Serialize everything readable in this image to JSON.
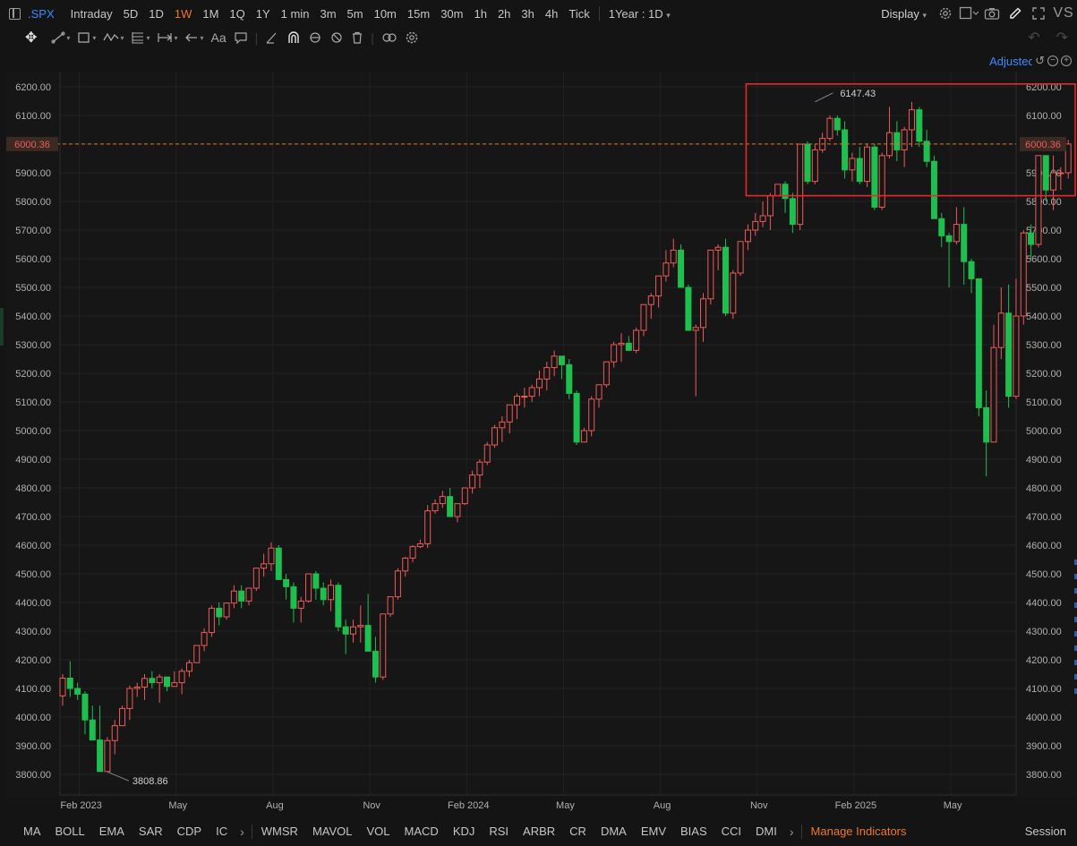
{
  "toolbar": {
    "symbol": ".SPX",
    "timeframes": [
      {
        "label": "Intraday",
        "active": false
      },
      {
        "label": "5D",
        "active": false
      },
      {
        "label": "1D",
        "active": false
      },
      {
        "label": "1W",
        "active": true
      },
      {
        "label": "1M",
        "active": false
      },
      {
        "label": "1Q",
        "active": false
      },
      {
        "label": "1Y",
        "active": false
      },
      {
        "label": "1 min",
        "active": false
      },
      {
        "label": "3m",
        "active": false
      },
      {
        "label": "5m",
        "active": false
      },
      {
        "label": "10m",
        "active": false
      },
      {
        "label": "15m",
        "active": false
      },
      {
        "label": "30m",
        "active": false
      },
      {
        "label": "1h",
        "active": false
      },
      {
        "label": "2h",
        "active": false
      },
      {
        "label": "3h",
        "active": false
      },
      {
        "label": "4h",
        "active": false
      },
      {
        "label": "Tick",
        "active": false
      }
    ],
    "range_label": "1Year : 1D",
    "display_label": "Display",
    "vs_label": "VS"
  },
  "price_mode": "Adjusted",
  "colors": {
    "up": "#f05a5a",
    "down": "#1fbf4f",
    "accent": "#f07828",
    "link": "#3d8bff",
    "current_line": "#e0762e",
    "highlight_box": "#e8282a"
  },
  "chart_data": {
    "type": "candlestick",
    "symbol": ".SPX",
    "interval": "1W",
    "ylim": [
      3750,
      6250
    ],
    "y_ticks": [
      "6200.00",
      "6100.00",
      "6000.00",
      "5900.00",
      "5800.00",
      "5700.00",
      "5600.00",
      "5500.00",
      "5400.00",
      "5300.00",
      "5200.00",
      "5100.00",
      "5000.00",
      "4900.00",
      "4800.00",
      "4700.00",
      "4600.00",
      "4500.00",
      "4400.00",
      "4300.00",
      "4200.00",
      "4100.00",
      "4000.00",
      "3900.00",
      "3800.00"
    ],
    "x_ticks": [
      {
        "label": "Feb 2023",
        "week": 2
      },
      {
        "label": "May",
        "week": 15
      },
      {
        "label": "Aug",
        "week": 28
      },
      {
        "label": "Nov",
        "week": 41
      },
      {
        "label": "Feb 2024",
        "week": 54
      },
      {
        "label": "May",
        "week": 67
      },
      {
        "label": "Aug",
        "week": 80
      },
      {
        "label": "Nov",
        "week": 93
      },
      {
        "label": "Feb 2025",
        "week": 106
      },
      {
        "label": "May",
        "week": 119
      }
    ],
    "current_price": "6000.36",
    "annotations": [
      {
        "label": "6147.43",
        "price": 6147.43,
        "week": 101
      },
      {
        "label": "3808.86",
        "price": 3808.86,
        "week": 6
      }
    ],
    "highlight_range": {
      "from_week": 92,
      "price_top": 6210,
      "price_bottom": 5820
    },
    "ohlc": [
      [
        4074,
        4150,
        4040,
        4136
      ],
      [
        4136,
        4195,
        4070,
        4100
      ],
      [
        4100,
        4120,
        4060,
        4080
      ],
      [
        4080,
        4090,
        3940,
        3990
      ],
      [
        3990,
        4040,
        3920,
        3920
      ],
      [
        3920,
        4040,
        3840,
        3810
      ],
      [
        3810,
        3930,
        3808.86,
        3918
      ],
      [
        3918,
        3990,
        3870,
        3970
      ],
      [
        3970,
        4040,
        3970,
        4030
      ],
      [
        4030,
        4110,
        3990,
        4100
      ],
      [
        4100,
        4120,
        4070,
        4105
      ],
      [
        4105,
        4150,
        4060,
        4135
      ],
      [
        4135,
        4160,
        4100,
        4120
      ],
      [
        4120,
        4150,
        4050,
        4140
      ],
      [
        4140,
        4140,
        4090,
        4107
      ],
      [
        4107,
        4160,
        4110,
        4120
      ],
      [
        4120,
        4170,
        4080,
        4160
      ],
      [
        4160,
        4200,
        4140,
        4190
      ],
      [
        4190,
        4250,
        4200,
        4250
      ],
      [
        4250,
        4310,
        4230,
        4295
      ],
      [
        4295,
        4390,
        4280,
        4380
      ],
      [
        4380,
        4400,
        4320,
        4350
      ],
      [
        4350,
        4400,
        4340,
        4398
      ],
      [
        4398,
        4460,
        4380,
        4440
      ],
      [
        4440,
        4460,
        4380,
        4405
      ],
      [
        4405,
        4450,
        4390,
        4450
      ],
      [
        4450,
        4520,
        4440,
        4520
      ],
      [
        4520,
        4570,
        4490,
        4535
      ],
      [
        4535,
        4610,
        4510,
        4590
      ],
      [
        4590,
        4600,
        4490,
        4480
      ],
      [
        4480,
        4500,
        4410,
        4455
      ],
      [
        4455,
        4470,
        4330,
        4380
      ],
      [
        4380,
        4420,
        4330,
        4405
      ],
      [
        4405,
        4480,
        4400,
        4500
      ],
      [
        4500,
        4510,
        4410,
        4450
      ],
      [
        4450,
        4470,
        4390,
        4410
      ],
      [
        4410,
        4480,
        4370,
        4460
      ],
      [
        4460,
        4470,
        4300,
        4315
      ],
      [
        4315,
        4340,
        4220,
        4290
      ],
      [
        4290,
        4340,
        4260,
        4315
      ],
      [
        4315,
        4390,
        4260,
        4320
      ],
      [
        4320,
        4430,
        4260,
        4230
      ],
      [
        4230,
        4280,
        4120,
        4140
      ],
      [
        4140,
        4360,
        4130,
        4360
      ],
      [
        4360,
        4420,
        4350,
        4420
      ],
      [
        4420,
        4520,
        4410,
        4510
      ],
      [
        4510,
        4560,
        4490,
        4555
      ],
      [
        4555,
        4600,
        4540,
        4595
      ],
      [
        4595,
        4620,
        4590,
        4605
      ],
      [
        4605,
        4740,
        4590,
        4720
      ],
      [
        4720,
        4760,
        4710,
        4745
      ],
      [
        4745,
        4790,
        4730,
        4770
      ],
      [
        4770,
        4800,
        4700,
        4700
      ],
      [
        4700,
        4720,
        4680,
        4745
      ],
      [
        4745,
        4790,
        4740,
        4800
      ],
      [
        4800,
        4860,
        4780,
        4845
      ],
      [
        4845,
        4900,
        4800,
        4890
      ],
      [
        4890,
        4960,
        4880,
        4950
      ],
      [
        4950,
        5020,
        4940,
        5010
      ],
      [
        5010,
        5050,
        4960,
        5030
      ],
      [
        5030,
        5060,
        4990,
        5090
      ],
      [
        5090,
        5130,
        5040,
        5120
      ],
      [
        5120,
        5150,
        5080,
        5120
      ],
      [
        5120,
        5160,
        5100,
        5150
      ],
      [
        5150,
        5210,
        5120,
        5180
      ],
      [
        5180,
        5240,
        5140,
        5220
      ],
      [
        5220,
        5280,
        5190,
        5260
      ],
      [
        5260,
        5260,
        5180,
        5230
      ],
      [
        5230,
        5250,
        5110,
        5130
      ],
      [
        5130,
        5140,
        4950,
        4960
      ],
      [
        4960,
        5010,
        4970,
        5000
      ],
      [
        5000,
        5120,
        4980,
        5110
      ],
      [
        5110,
        5150,
        5080,
        5160
      ],
      [
        5160,
        5200,
        5150,
        5240
      ],
      [
        5240,
        5310,
        5220,
        5300
      ],
      [
        5300,
        5340,
        5240,
        5305
      ],
      [
        5305,
        5330,
        5280,
        5280
      ],
      [
        5280,
        5360,
        5270,
        5350
      ],
      [
        5350,
        5400,
        5330,
        5440
      ],
      [
        5440,
        5480,
        5390,
        5470
      ],
      [
        5470,
        5540,
        5430,
        5540
      ],
      [
        5540,
        5630,
        5520,
        5585
      ],
      [
        5585,
        5670,
        5570,
        5630
      ],
      [
        5630,
        5650,
        5500,
        5500
      ],
      [
        5500,
        5510,
        5380,
        5350
      ],
      [
        5350,
        5370,
        5120,
        5360
      ],
      [
        5360,
        5480,
        5310,
        5460
      ],
      [
        5460,
        5600,
        5440,
        5630
      ],
      [
        5630,
        5650,
        5560,
        5640
      ],
      [
        5640,
        5670,
        5400,
        5410
      ],
      [
        5410,
        5560,
        5390,
        5550
      ],
      [
        5550,
        5660,
        5540,
        5660
      ],
      [
        5660,
        5720,
        5630,
        5700
      ],
      [
        5700,
        5760,
        5680,
        5730
      ],
      [
        5730,
        5800,
        5710,
        5750
      ],
      [
        5750,
        5830,
        5700,
        5820
      ],
      [
        5820,
        5860,
        5820,
        5860
      ],
      [
        5860,
        5870,
        5760,
        5810
      ],
      [
        5810,
        5830,
        5690,
        5720
      ],
      [
        5720,
        5880,
        5700,
        6000
      ],
      [
        6000,
        6010,
        5860,
        5870
      ],
      [
        5870,
        6000,
        5860,
        5980
      ],
      [
        5980,
        6040,
        5970,
        6020
      ],
      [
        6020,
        6100,
        6010,
        6090
      ],
      [
        6090,
        6100,
        6030,
        6050
      ],
      [
        6050,
        6080,
        5880,
        5910
      ],
      [
        5910,
        5970,
        5870,
        5950
      ],
      [
        5950,
        5990,
        5860,
        5870
      ],
      [
        5870,
        6000,
        5850,
        5990
      ],
      [
        5990,
        6000,
        5770,
        5780
      ],
      [
        5780,
        5970,
        5770,
        5960
      ],
      [
        5960,
        6130,
        5950,
        6040
      ],
      [
        6040,
        6080,
        5940,
        5980
      ],
      [
        5980,
        6060,
        5920,
        6050
      ],
      [
        6050,
        6147.43,
        5990,
        6120
      ],
      [
        6120,
        6130,
        5990,
        6010
      ],
      [
        6010,
        6050,
        5920,
        5940
      ],
      [
        5940,
        5960,
        5770,
        5740
      ],
      [
        5740,
        5760,
        5640,
        5680
      ],
      [
        5680,
        5690,
        5500,
        5660
      ],
      [
        5660,
        5780,
        5650,
        5720
      ],
      [
        5720,
        5780,
        5510,
        5590
      ],
      [
        5590,
        5600,
        5480,
        5530
      ],
      [
        5530,
        5530,
        5050,
        5080
      ],
      [
        5080,
        5140,
        4840,
        4960
      ],
      [
        4960,
        5370,
        4960,
        5290
      ],
      [
        5290,
        5500,
        5250,
        5410
      ],
      [
        5410,
        5510,
        5080,
        5120
      ],
      [
        5120,
        5530,
        5110,
        5400
      ],
      [
        5400,
        5700,
        5370,
        5690
      ],
      [
        5690,
        5720,
        5600,
        5650
      ],
      [
        5650,
        5960,
        5640,
        5960
      ],
      [
        5960,
        5960,
        5800,
        5840
      ],
      [
        5840,
        5960,
        5770,
        5900
      ],
      [
        5900,
        5920,
        5840,
        5900
      ],
      [
        5900,
        6015,
        5880,
        6000.36
      ]
    ]
  },
  "indicators_bar": {
    "main": [
      "MA",
      "BOLL",
      "EMA",
      "SAR",
      "CDP",
      "IC"
    ],
    "sub": [
      "WMSR",
      "MAVOL",
      "VOL",
      "MACD",
      "KDJ",
      "RSI",
      "ARBR",
      "CR",
      "DMA",
      "EMV",
      "BIAS",
      "CCI",
      "DMI"
    ],
    "manage_label": "Manage Indicators",
    "session_label": "Session"
  }
}
